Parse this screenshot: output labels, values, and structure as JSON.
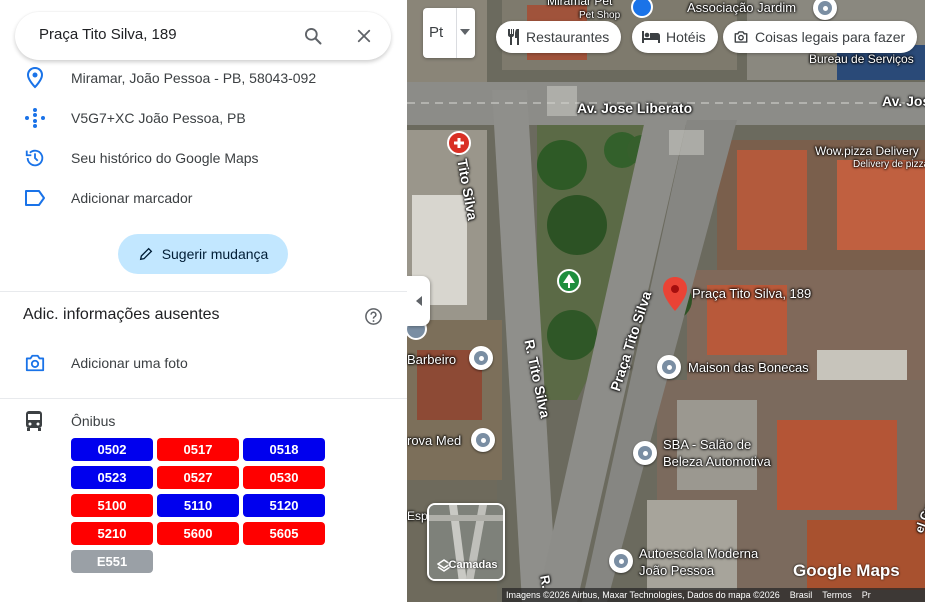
{
  "search": {
    "query": "Praça Tito Silva, 189"
  },
  "info": {
    "address": "Miramar, João Pessoa - PB, 58043-092",
    "plus_code": "V5G7+XC João Pessoa, PB",
    "history": "Seu histórico do Google Maps",
    "add_label": "Adicionar marcador",
    "suggest_edit": "Sugerir mudança"
  },
  "missing_info": {
    "title": "Adic. informações ausentes",
    "add_photo": "Adicionar uma foto"
  },
  "transit": {
    "label": "Ônibus",
    "routes": [
      {
        "code": "0502",
        "color": "#0000ee"
      },
      {
        "code": "0517",
        "color": "#ff0000"
      },
      {
        "code": "0518",
        "color": "#0000ee"
      },
      {
        "code": "0523",
        "color": "#0000ee"
      },
      {
        "code": "0527",
        "color": "#ff0000"
      },
      {
        "code": "0530",
        "color": "#ff0000"
      },
      {
        "code": "5100",
        "color": "#ff0000"
      },
      {
        "code": "5110",
        "color": "#0000ee"
      },
      {
        "code": "5120",
        "color": "#0000ee"
      },
      {
        "code": "5210",
        "color": "#ff0000"
      },
      {
        "code": "5600",
        "color": "#ff0000"
      },
      {
        "code": "5605",
        "color": "#ff0000"
      },
      {
        "code": "E551",
        "color": "#9aa0a6"
      }
    ]
  },
  "map": {
    "translate_label": "Pt",
    "chips": {
      "restaurants": "Restaurantes",
      "hotels": "Hotéis",
      "things_to_do": "Coisas legais para fazer"
    },
    "layers_label": "Camadas",
    "labels": {
      "street_tito_silva_1": "R. Tito Silva",
      "street_tito_silva_2": "R. Tito Silva",
      "praca": "Praça Tito Silva",
      "av_jose": "Av. Jose Liberato",
      "av_right": "Av. Jos",
      "miramar_pet": "Miramar Pet",
      "pet_shop": "Pet Shop",
      "associacao": "Associação Jardim",
      "bureau": "Bureau de Serviços",
      "wow_pizza": "Wow.pizza Delivery",
      "delivery_pizza": "Delivery de pizza",
      "selected_place": "Praça Tito Silva, 189",
      "maison": "Maison das Bonecas",
      "barbeiro": "Barbeiro",
      "prova_med": "rova Med",
      "esp": "Esp",
      "sba_1": "SBA - Salão de",
      "sba_2": "Beleza Automotiva",
      "autoescola_1": "Autoescola Moderna",
      "autoescola_2": "João Pessoa",
      "r_bottom": "R.",
      "r_gualbert": "el Gualbert"
    },
    "google_logo": "Google Maps",
    "attribution": {
      "imagery": "Imagens ©2026 Airbus, Maxar Technologies, Dados do mapa ©2026",
      "country": "Brasil",
      "terms": "Termos",
      "privacy": "Pr"
    },
    "colors": {
      "pin_red": "#ea4335",
      "park_green": "#1e8e3e",
      "hospital_red": "#d93025"
    }
  }
}
